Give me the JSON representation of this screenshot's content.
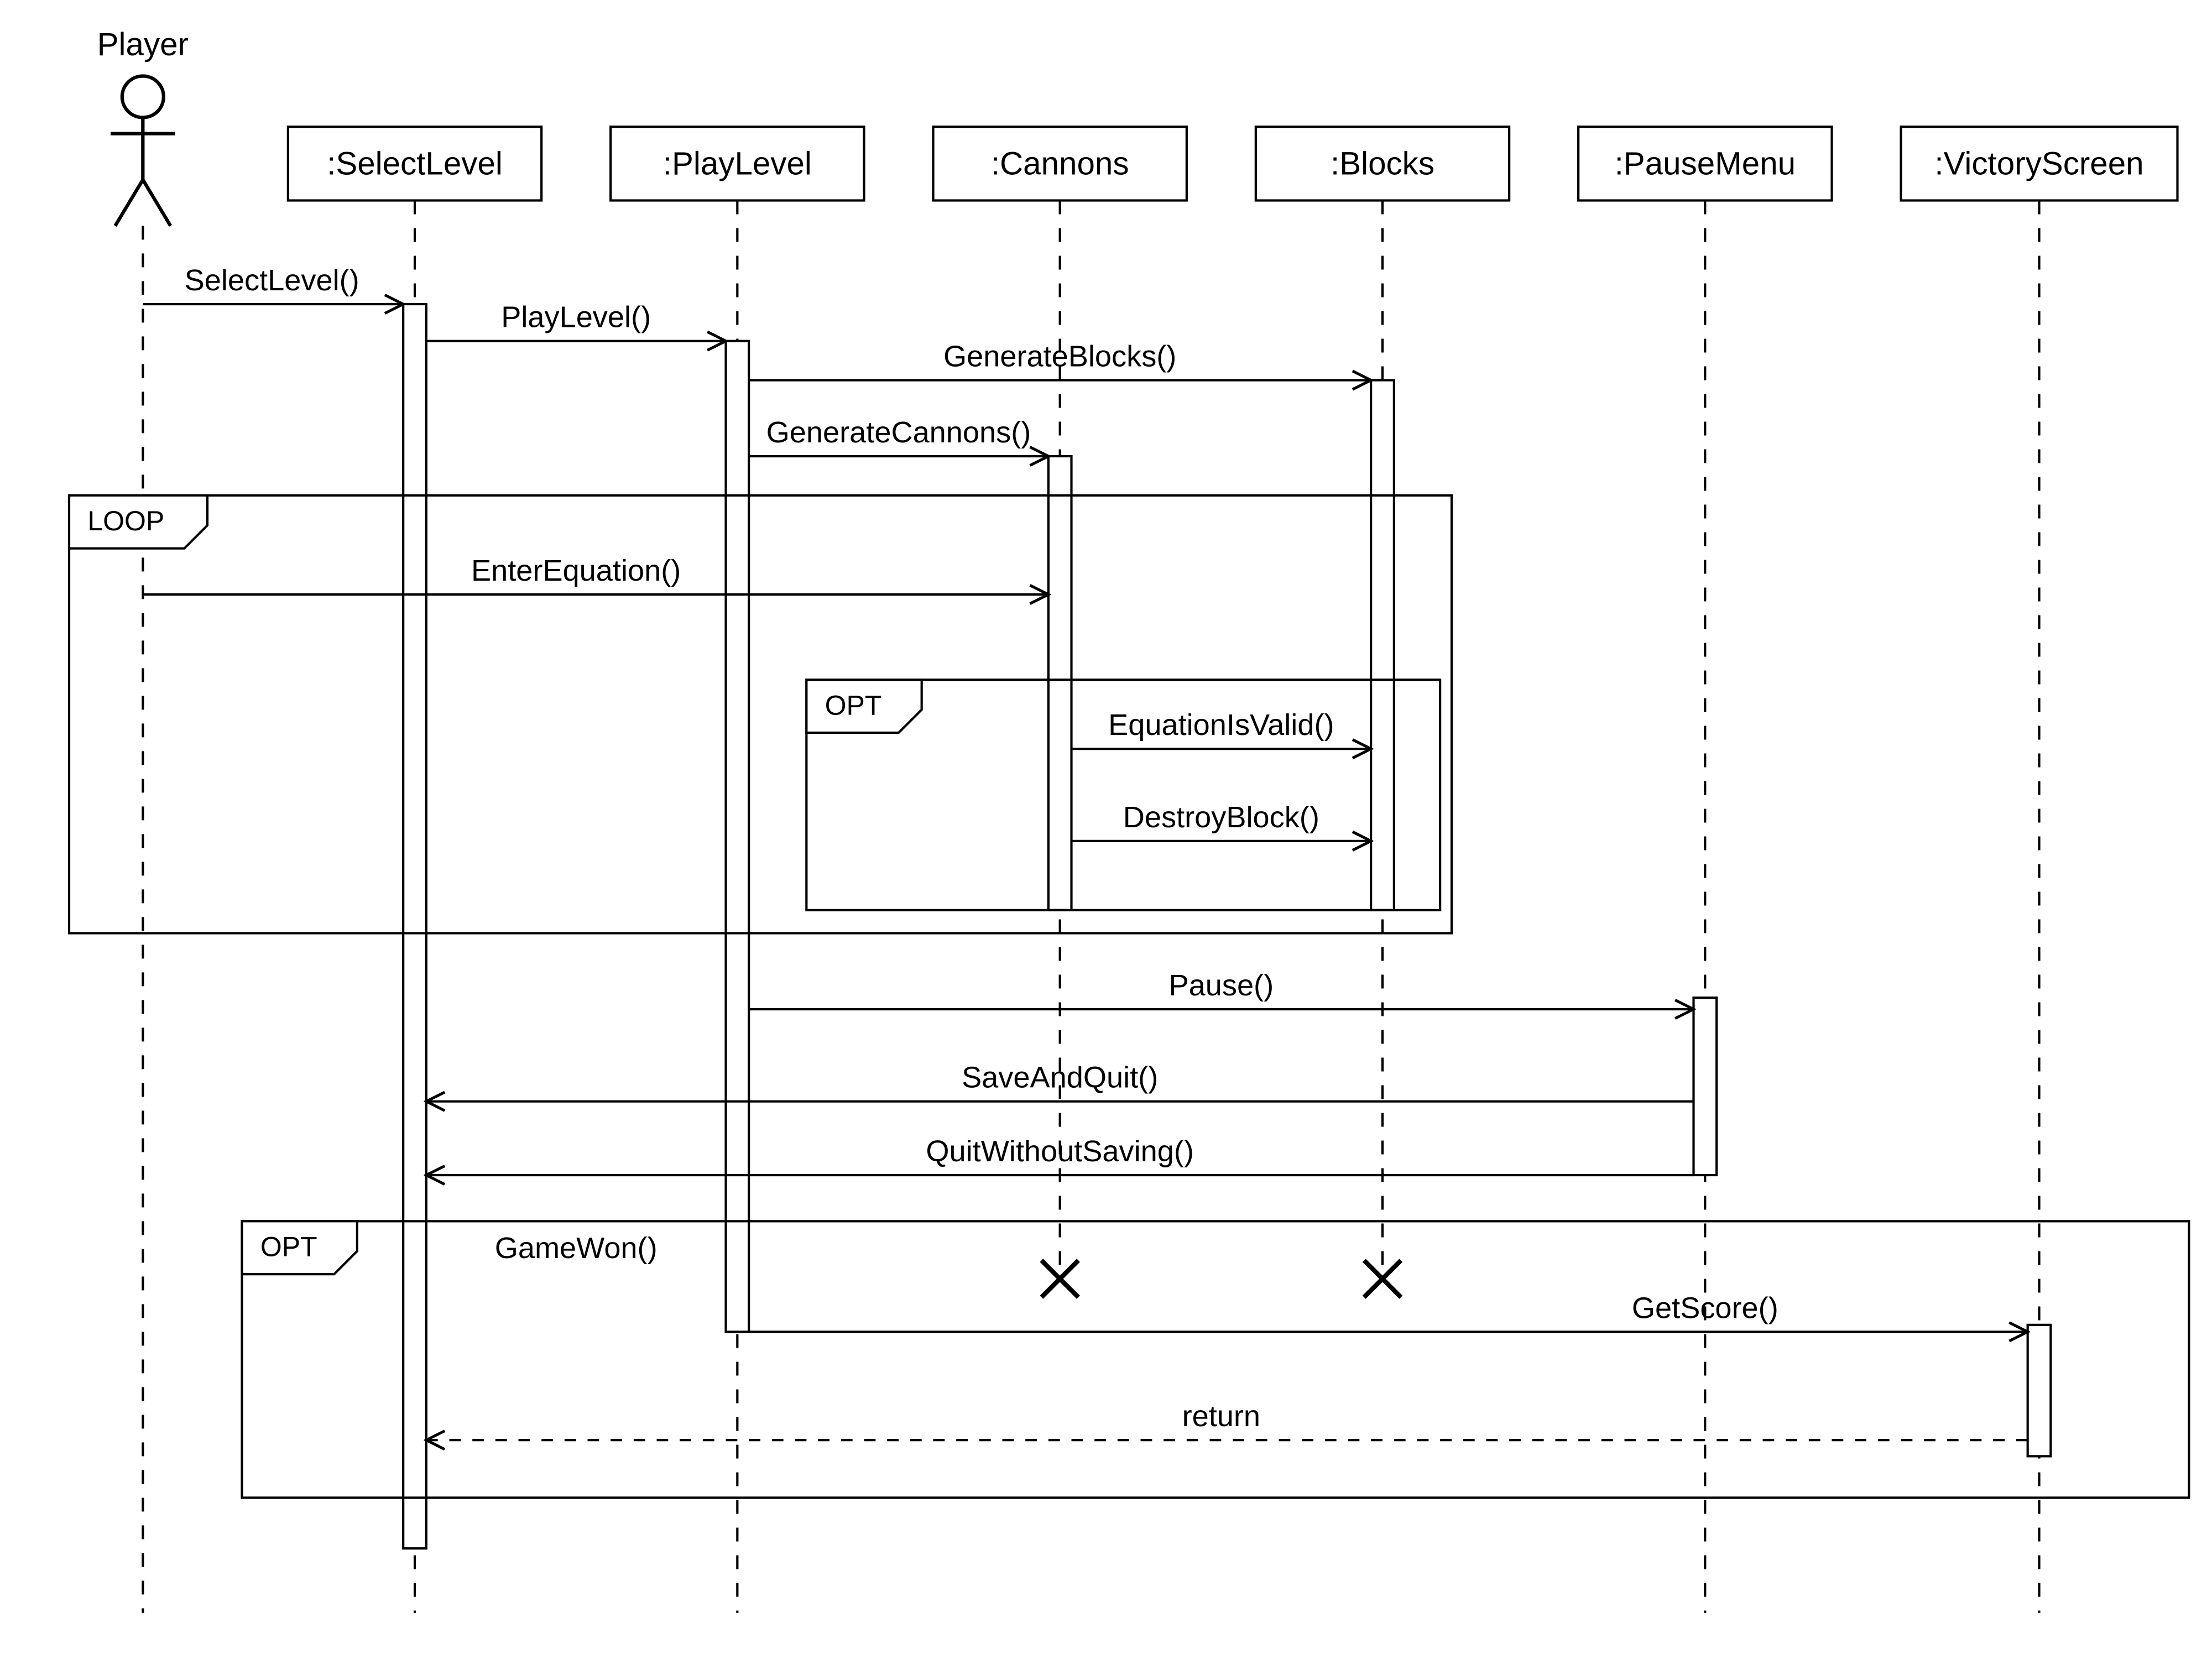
{
  "actor": {
    "label": "Player"
  },
  "lifelines": {
    "selectLevel": ":SelectLevel",
    "playLevel": ":PlayLevel",
    "cannons": ":Cannons",
    "blocks": ":Blocks",
    "pauseMenu": ":PauseMenu",
    "victoryScreen": ":VictoryScreen"
  },
  "messages": {
    "selectLevel": "SelectLevel()",
    "playLevel": "PlayLevel()",
    "generateBlocks": "GenerateBlocks()",
    "generateCannons": "GenerateCannons()",
    "enterEquation": "EnterEquation()",
    "equationIsValid": "EquationIsValid()",
    "destroyBlock": "DestroyBlock()",
    "pause": "Pause()",
    "saveAndQuit": "SaveAndQuit()",
    "quitWithoutSaving": "QuitWithoutSaving()",
    "gameWon": "GameWon()",
    "getScore": "GetScore()",
    "return": "return"
  },
  "frames": {
    "loop": "LOOP",
    "optInner": "OPT",
    "optOuter": "OPT"
  }
}
